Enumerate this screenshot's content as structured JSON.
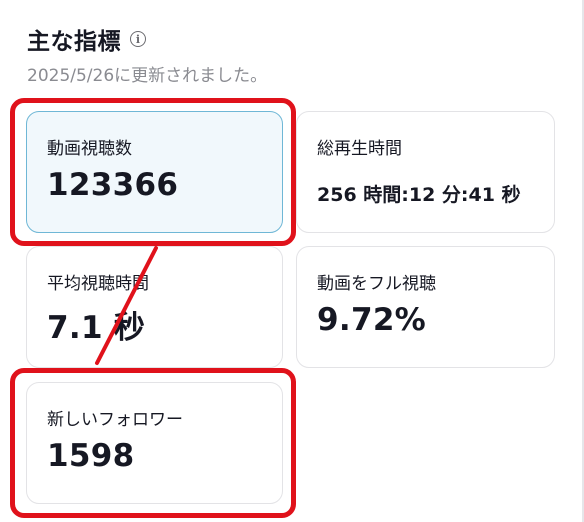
{
  "header": {
    "title": "主な指標",
    "info_icon": "info-circle-icon",
    "updated": "2025/5/26に更新されました。"
  },
  "metrics": [
    {
      "label": "動画視聴数",
      "value": "123366"
    },
    {
      "label": "総再生時間",
      "value": "256 時間:12 分:41 秒"
    },
    {
      "label": "平均視聴時間",
      "value": "7.1 秒"
    },
    {
      "label": "動画をフル視聴",
      "value": "9.72%"
    },
    {
      "label": "新しいフォロワー",
      "value": "1598"
    }
  ],
  "colors": {
    "highlight": "#e0121b",
    "selected_card_bg": "#f1f8fc",
    "selected_card_border": "#6fb7d6"
  }
}
